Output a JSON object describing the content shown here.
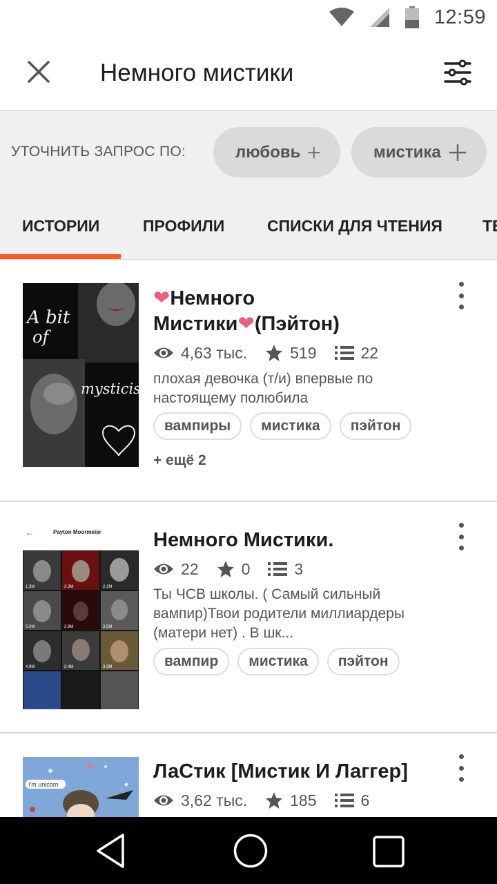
{
  "status_bar": {
    "time": "12:59",
    "icons": [
      "wifi-icon",
      "cell-signal-icon",
      "battery-icon"
    ]
  },
  "header": {
    "title": "Немного мистики",
    "close_icon": "close-icon",
    "filter_icon": "filter-sliders-icon"
  },
  "refine": {
    "label": "УТОЧНИТЬ ЗАПРОС ПО:",
    "chips": [
      {
        "label": "любовь"
      },
      {
        "label": "мистика"
      }
    ]
  },
  "tabs": [
    {
      "label": "ИСТОРИИ",
      "active": true
    },
    {
      "label": "ПРОФИЛИ"
    },
    {
      "label": "СПИСКИ ДЛЯ ЧТЕНИЯ"
    },
    {
      "label": "ТЕ"
    }
  ],
  "stories": [
    {
      "title_part1": "Немного",
      "title_part2": "Мистики",
      "title_part3": "(Пэйтон)",
      "views": "4,63 тыс.",
      "votes": "519",
      "parts": "22",
      "description": "плохая девочка (т/и) впервые по настоящему полюбила",
      "tags": [
        "вампиры",
        "мистика",
        "пэйтон"
      ],
      "more_tags": "+ ещё 2",
      "cover_text": [
        "A bit",
        "of",
        "mysticis"
      ]
    },
    {
      "title": "Немного Мистики.",
      "views": "22",
      "votes": "0",
      "parts": "3",
      "description": "Ты ЧСВ школы. ( Самый сильный вампир)Твои родители миллиардеры (матери нет) . В шк...",
      "tags": [
        "вампир",
        "мистика",
        "пэйтон"
      ],
      "cover_text": {
        "profile_name": "Payton Moormeier",
        "views": [
          "1.3M",
          "2.3M",
          "2.2M",
          "5.0M",
          "2.9M",
          "3.5M",
          "4.9M",
          "2.4M",
          "3.3M"
        ]
      }
    },
    {
      "title": "ЛаСтик [Мистик И Лаггер]",
      "views": "3,62 тыс.",
      "votes": "185",
      "parts": "6",
      "cover_text": "I'm unicorn"
    }
  ],
  "colors": {
    "accent": "#ff5a1f",
    "heart": "#e8607a",
    "chip_bg": "#dadada"
  }
}
